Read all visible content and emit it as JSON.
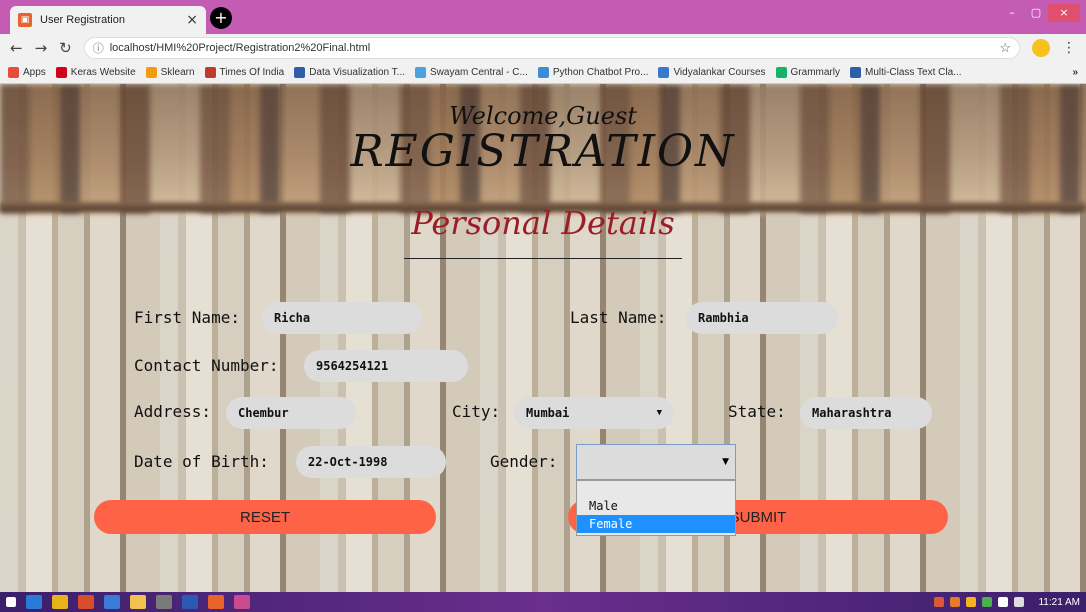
{
  "browser": {
    "tab_title": "User Registration",
    "tab_close": "×",
    "new_tab": "+",
    "url": "localhost/HMI%20Project/Registration2%20Final.html",
    "window_controls": [
      "–",
      "▢",
      "×"
    ],
    "bookmarks": [
      {
        "label": "Apps",
        "color": "#e74c3c"
      },
      {
        "label": "Keras Website",
        "color": "#d0021b"
      },
      {
        "label": "Sklearn",
        "color": "#f39c12"
      },
      {
        "label": "Times Of India",
        "color": "#c0392b"
      },
      {
        "label": "Data Visualization T...",
        "color": "#2f5fa8"
      },
      {
        "label": "Swayam Central - C...",
        "color": "#4aa3df"
      },
      {
        "label": "Python Chatbot Pro...",
        "color": "#3b8bd6"
      },
      {
        "label": "Vidyalankar Courses",
        "color": "#3a79c9"
      },
      {
        "label": "Grammarly",
        "color": "#15b26c"
      },
      {
        "label": "Multi-Class Text Cla...",
        "color": "#2f5fa8"
      }
    ],
    "bookmarks_more": "»"
  },
  "page": {
    "welcome": "Welcome,Guest",
    "heading": "REGISTRATION",
    "subheading": "Personal Details"
  },
  "form": {
    "first_name_label": "First Name:",
    "first_name_value": "Richa",
    "last_name_label": "Last Name:",
    "last_name_value": "Rambhia",
    "contact_label": "Contact Number:",
    "contact_value": "9564254121",
    "address_label": "Address:",
    "address_value": "Chembur",
    "city_label": "City:",
    "city_value": "Mumbai",
    "state_label": "State:",
    "state_value": "Maharashtra",
    "dob_label": "Date of Birth:",
    "dob_value": "22-Oct-1998",
    "gender_label": "Gender:",
    "gender_options": [
      "Male",
      "Female"
    ],
    "gender_highlighted": "Female",
    "reset_label": "RESET",
    "submit_label": "SUBMIT"
  },
  "taskbar": {
    "clock": "11:21 AM"
  }
}
